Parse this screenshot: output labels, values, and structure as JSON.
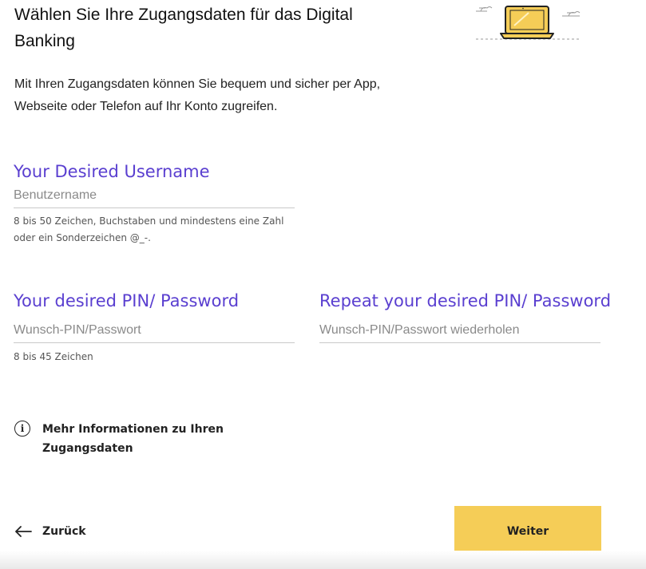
{
  "header": {
    "title": "Wählen Sie Ihre Zugangsdaten für das Digital Banking",
    "intro": "Mit Ihren Zugangsdaten können Sie bequem und sicher per App, Webseite oder Telefon auf Ihr Konto zugreifen.",
    "illustration": "laptop-illustration"
  },
  "form": {
    "username": {
      "label": "Your Desired Username",
      "placeholder": "Benutzername",
      "hint": "8 bis 50 Zeichen, Buchstaben und mindestens eine Zahl oder ein Sonderzeichen @_-."
    },
    "password": {
      "label": "Your desired PIN/ Password",
      "placeholder": "Wunsch-PIN/Passwort",
      "hint": "8 bis 45 Zeichen"
    },
    "repeat_password": {
      "label": "Repeat your desired PIN/ Password",
      "placeholder": "Wunsch-PIN/Passwort wiederholen"
    }
  },
  "info": {
    "icon": "info-icon",
    "text": "Mehr Informationen zu Ihren Zugangsdaten"
  },
  "footer": {
    "back_label": "Zurück",
    "next_label": "Weiter"
  },
  "colors": {
    "accent": "#5a3fd0",
    "button": "#f5cd57",
    "text": "#1a1a1a"
  }
}
